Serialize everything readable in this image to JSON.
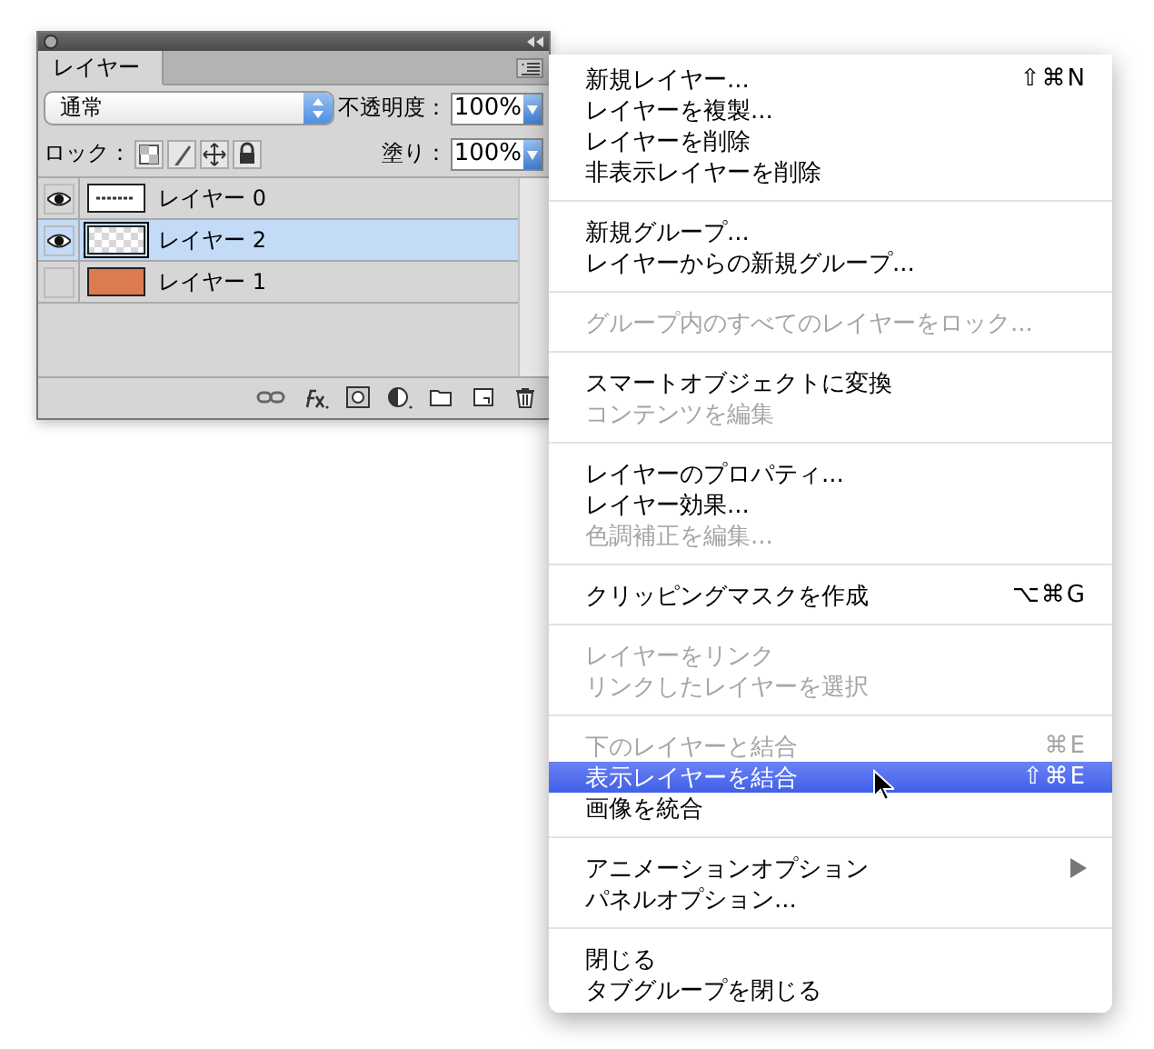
{
  "panel": {
    "tab": {
      "label": "レイヤー",
      "selected": true
    },
    "blend_mode": "通常",
    "opacity_label": "不透明度：",
    "opacity": "100%",
    "lock_label": "ロック：",
    "fill_label": "塗り：",
    "fill": "100%",
    "layers": [
      {
        "name": "レイヤー 0",
        "visible": true,
        "selected": false,
        "kind": "text"
      },
      {
        "name": "レイヤー 2",
        "visible": true,
        "selected": true,
        "kind": "transparent"
      },
      {
        "name": "レイヤー 1",
        "visible": false,
        "selected": false,
        "kind": "fill",
        "color": "#dc7a50"
      }
    ]
  },
  "menu": {
    "groups": [
      [
        {
          "label": "新規レイヤー...",
          "shortcut": "⇧⌘N",
          "disabled": false,
          "selected": false,
          "submenu": false
        },
        {
          "label": "レイヤーを複製...",
          "disabled": false,
          "selected": false,
          "submenu": false
        },
        {
          "label": "レイヤーを削除",
          "disabled": false,
          "selected": false,
          "submenu": false
        },
        {
          "label": "非表示レイヤーを削除",
          "disabled": false,
          "selected": false,
          "submenu": false
        }
      ],
      [
        {
          "label": "新規グループ...",
          "disabled": false,
          "selected": false,
          "submenu": false
        },
        {
          "label": "レイヤーからの新規グループ...",
          "disabled": false,
          "selected": false,
          "submenu": false
        }
      ],
      [
        {
          "label": "グループ内のすべてのレイヤーをロック...",
          "disabled": true,
          "selected": false,
          "submenu": false
        }
      ],
      [
        {
          "label": "スマートオブジェクトに変換",
          "disabled": false,
          "selected": false,
          "submenu": false
        },
        {
          "label": "コンテンツを編集",
          "disabled": true,
          "selected": false,
          "submenu": false
        }
      ],
      [
        {
          "label": "レイヤーのプロパティ...",
          "disabled": false,
          "selected": false,
          "submenu": false
        },
        {
          "label": "レイヤー効果...",
          "disabled": false,
          "selected": false,
          "submenu": false
        },
        {
          "label": "色調補正を編集...",
          "disabled": true,
          "selected": false,
          "submenu": false
        }
      ],
      [
        {
          "label": "クリッピングマスクを作成",
          "shortcut": "⌥⌘G",
          "disabled": false,
          "selected": false,
          "submenu": false
        }
      ],
      [
        {
          "label": "レイヤーをリンク",
          "disabled": true,
          "selected": false,
          "submenu": false
        },
        {
          "label": "リンクしたレイヤーを選択",
          "disabled": true,
          "selected": false,
          "submenu": false
        }
      ],
      [
        {
          "label": "下のレイヤーと結合",
          "shortcut": "⌘E",
          "disabled": true,
          "selected": false,
          "submenu": false
        },
        {
          "label": "表示レイヤーを結合",
          "shortcut": "⇧⌘E",
          "disabled": false,
          "selected": true,
          "submenu": false
        },
        {
          "label": "画像を統合",
          "disabled": false,
          "selected": false,
          "submenu": false
        }
      ],
      [
        {
          "label": "アニメーションオプション",
          "disabled": false,
          "selected": false,
          "submenu": true
        },
        {
          "label": "パネルオプション...",
          "disabled": false,
          "selected": false,
          "submenu": false
        }
      ],
      [
        {
          "label": "閉じる",
          "disabled": false,
          "selected": false,
          "submenu": false
        },
        {
          "label": "タブグループを閉じる",
          "disabled": false,
          "selected": false,
          "submenu": false
        }
      ]
    ]
  }
}
